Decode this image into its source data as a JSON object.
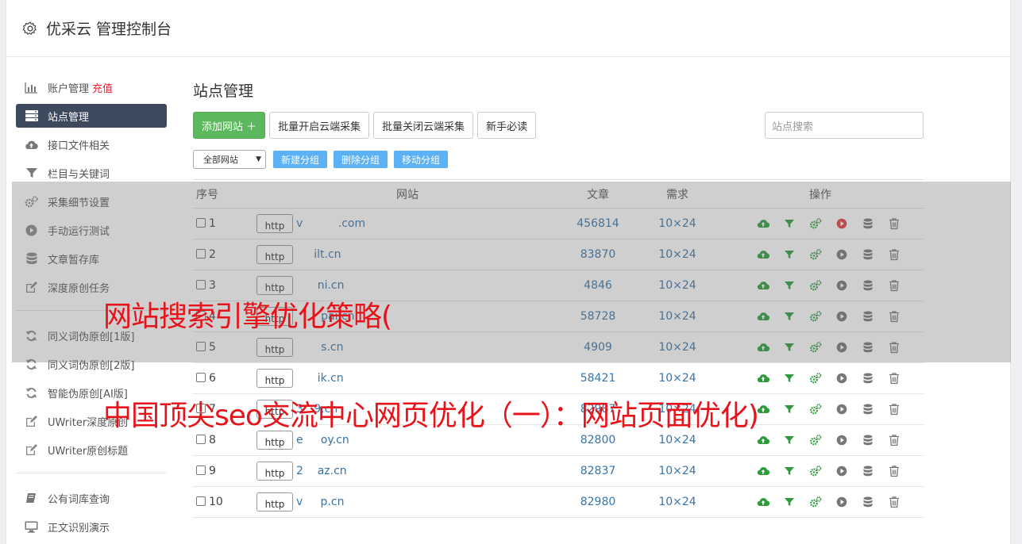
{
  "header": {
    "title": "优采云 管理控制台"
  },
  "sidebar": {
    "items": [
      {
        "label": "账户管理",
        "extra": "充值",
        "icon": "bar-chart-icon",
        "active": false
      },
      {
        "label": "站点管理",
        "icon": "server-list-icon",
        "active": true
      },
      {
        "label": "接口文件相关",
        "icon": "cloud-upload-icon",
        "active": false
      },
      {
        "label": "栏目与关键词",
        "icon": "filter-icon",
        "active": false
      },
      {
        "label": "采集细节设置",
        "icon": "gears-icon",
        "active": false
      },
      {
        "label": "手动运行测试",
        "icon": "play-circle-icon",
        "active": false
      },
      {
        "label": "文章暂存库",
        "icon": "database-icon",
        "active": false
      },
      {
        "label": "深度原创任务",
        "icon": "edit-icon",
        "active": false
      }
    ],
    "items2": [
      {
        "label": "同义词伪原创[1版]",
        "icon": "refresh-icon"
      },
      {
        "label": "同义词伪原创[2版]",
        "icon": "refresh-icon"
      },
      {
        "label": "智能伪原创[AI版]",
        "icon": "refresh-icon"
      },
      {
        "label": "UWriter深度原创",
        "icon": "edit-icon"
      },
      {
        "label": "UWriter原创标题",
        "icon": "edit-icon"
      }
    ],
    "items3": [
      {
        "label": "公有词库查询",
        "icon": "book-icon"
      },
      {
        "label": "正文识别演示",
        "icon": "monitor-icon"
      }
    ]
  },
  "main": {
    "title": "站点管理",
    "buttons": {
      "add": "添加网站 ＋",
      "batch_open": "批量开启云端采集",
      "batch_close": "批量关闭云端采集",
      "guide": "新手必读"
    },
    "search_placeholder": "站点搜索",
    "group_select": "全部网站",
    "group_buttons": {
      "new": "新建分组",
      "delete": "删除分组",
      "move": "移动分组"
    },
    "table": {
      "headers": {
        "no": "序号",
        "site": "网站",
        "articles": "文章",
        "demand": "需求",
        "ops": "操作"
      },
      "rows": [
        {
          "no": "1",
          "proto": "http",
          "domain": "v          .com",
          "articles": "456814",
          "demand": "10×24",
          "active": true
        },
        {
          "no": "2",
          "proto": "http",
          "domain": "     ilt.cn",
          "articles": "83870",
          "demand": "10×24",
          "active": false
        },
        {
          "no": "3",
          "proto": "http",
          "domain": "      ni.cn",
          "articles": "4846",
          "demand": "10×24",
          "active": false
        },
        {
          "no": "4",
          "proto": "http",
          "domain": "       pai.cn",
          "articles": "58728",
          "demand": "10×24",
          "active": false
        },
        {
          "no": "5",
          "proto": "http",
          "domain": "       s.cn",
          "articles": "4909",
          "demand": "10×24",
          "active": false
        },
        {
          "no": "6",
          "proto": "http",
          "domain": "      ik.cn",
          "articles": "58421",
          "demand": "10×24",
          "active": false
        },
        {
          "no": "7",
          "proto": "http",
          "domain": "3   9.cn",
          "articles": "82987",
          "demand": "10×24",
          "active": false
        },
        {
          "no": "8",
          "proto": "http",
          "domain": "e     oy.cn",
          "articles": "82800",
          "demand": "10×24",
          "active": false
        },
        {
          "no": "9",
          "proto": "http",
          "domain": "2    az.cn",
          "articles": "82837",
          "demand": "10×24",
          "active": false
        },
        {
          "no": "10",
          "proto": "http",
          "domain": "v     p.cn",
          "articles": "82980",
          "demand": "10×24",
          "active": false
        }
      ]
    }
  },
  "overlay": {
    "line1": "网站搜索引擎优化策略(",
    "line2": "中国顶尖seo交流中心网页优化（一）：网站页面优化)"
  },
  "colors": {
    "sidebar_active": "#3d4a5d",
    "green": "#5cb85c",
    "link": "#3874a8",
    "overlay_text": "#e8131a",
    "play_active": "#e43d3d"
  }
}
